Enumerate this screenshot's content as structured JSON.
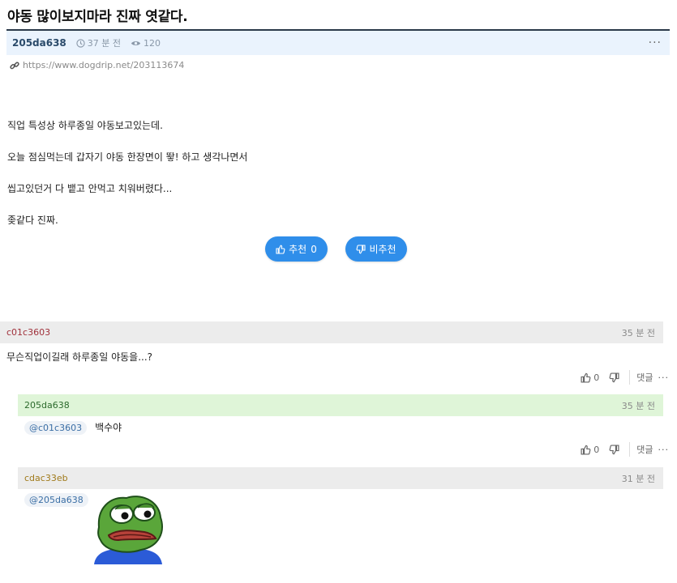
{
  "post": {
    "title": "야동 많이보지마라 진짜 엿같다.",
    "author": "205da638",
    "time_ago": "37 분 전",
    "views": "120",
    "more": "···",
    "url": "https://www.dogdrip.net/203113674",
    "paragraphs": [
      "직업 특성상 하루종일 야동보고있는데.",
      "오늘 점심먹는데 갑자기 야동 한장면이 뙇! 하고 생각나면서",
      "씹고있던거 다 뱉고 안먹고 치워버렸다...",
      "좆같다 진짜."
    ],
    "upvote_label": "추천",
    "upvote_count": "0",
    "downvote_label": "비추천"
  },
  "comments": [
    {
      "author": "c01c3603",
      "time_ago": "35 분 전",
      "text": "무슨직업이길래 하루종일 야동을...?",
      "likes": "0",
      "reply_label": "댓글",
      "more": "···"
    },
    {
      "author": "205da638",
      "time_ago": "35 분 전",
      "mention": "@c01c3603",
      "text": "백수야",
      "likes": "0",
      "reply_label": "댓글",
      "more": "···"
    },
    {
      "author": "cdac33eb",
      "time_ago": "31 분 전",
      "mention": "@205da638"
    }
  ],
  "colors": {
    "accent": "#2f8eea",
    "meta_bg": "#eaf3fd",
    "comment_bg": "#ececec",
    "author_reply_bg": "#dff5d8"
  },
  "icons": [
    "clock-icon",
    "eye-icon",
    "link-icon",
    "thumbs-up-icon",
    "thumbs-down-icon",
    "frog-sticker"
  ]
}
